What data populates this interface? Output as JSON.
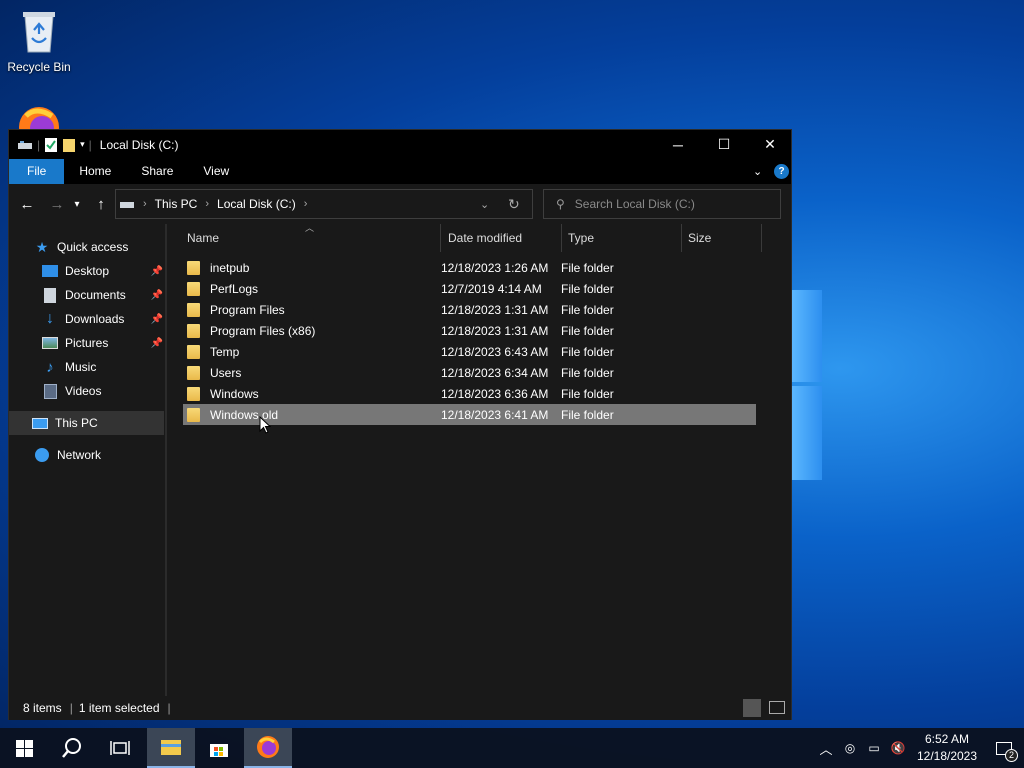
{
  "desktop": {
    "icons": [
      {
        "label": "Recycle Bin"
      }
    ]
  },
  "window": {
    "title": "Local Disk (C:)",
    "ribbon_tabs": [
      "File",
      "Home",
      "Share",
      "View"
    ],
    "breadcrumb": [
      "This PC",
      "Local Disk (C:)"
    ],
    "search_placeholder": "Search Local Disk (C:)",
    "nav": {
      "quick_access": "Quick access",
      "items": [
        {
          "label": "Desktop",
          "icon": "desktop-icon",
          "pinned": true
        },
        {
          "label": "Documents",
          "icon": "documents-icon",
          "pinned": true
        },
        {
          "label": "Downloads",
          "icon": "downloads-icon",
          "pinned": true
        },
        {
          "label": "Pictures",
          "icon": "pictures-icon",
          "pinned": true
        },
        {
          "label": "Music",
          "icon": "music-icon",
          "pinned": false
        },
        {
          "label": "Videos",
          "icon": "videos-icon",
          "pinned": false
        }
      ],
      "this_pc": "This PC",
      "network": "Network"
    },
    "columns": {
      "name": "Name",
      "date": "Date modified",
      "type": "Type",
      "size": "Size"
    },
    "files": [
      {
        "name": "inetpub",
        "date": "12/18/2023 1:26 AM",
        "type": "File folder"
      },
      {
        "name": "PerfLogs",
        "date": "12/7/2019 4:14 AM",
        "type": "File folder"
      },
      {
        "name": "Program Files",
        "date": "12/18/2023 1:31 AM",
        "type": "File folder"
      },
      {
        "name": "Program Files (x86)",
        "date": "12/18/2023 1:31 AM",
        "type": "File folder"
      },
      {
        "name": "Temp",
        "date": "12/18/2023 6:43 AM",
        "type": "File folder"
      },
      {
        "name": "Users",
        "date": "12/18/2023 6:34 AM",
        "type": "File folder"
      },
      {
        "name": "Windows",
        "date": "12/18/2023 6:36 AM",
        "type": "File folder"
      },
      {
        "name": "Windows.old",
        "date": "12/18/2023 6:41 AM",
        "type": "File folder",
        "selected": true
      }
    ],
    "status": {
      "count": "8 items",
      "selected": "1 item selected"
    }
  },
  "taskbar": {
    "time": "6:52 AM",
    "date": "12/18/2023",
    "notifications": "2"
  },
  "colors": {
    "accent": "#1979ca",
    "window_bg": "#191919",
    "selected_row": "#777777"
  }
}
